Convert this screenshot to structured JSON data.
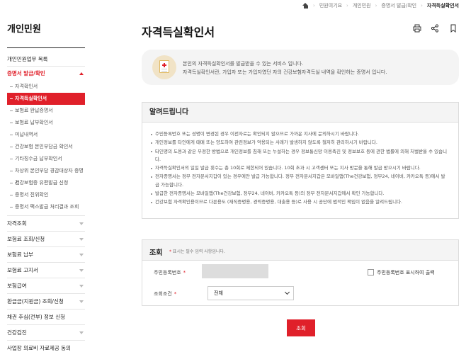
{
  "breadcrumb": {
    "items": [
      "민원여기요",
      "개인민원",
      "증명서 발급/확인"
    ],
    "current": "자격득실확인서"
  },
  "sidebar": {
    "title": "개인민원",
    "top_item": "개인민원업무 목록",
    "section": "증명서 발급/확인",
    "sub_items": [
      "자격확인서",
      "자격득실확인서",
      "보험료 완납증명서",
      "보험료 납부확인서",
      "미납내역서",
      "건강보험 본인부담금 확인서",
      "기타징수금 납부확인서",
      "차상위 본인부담 경감대상자 증명서",
      "건강보험증 유편발급 신청",
      "증명서 진위확인",
      "증명서 팩스발급 처리결과 조회"
    ],
    "main_items": [
      "자격조회",
      "보험료 조회/신청",
      "보험료 납부",
      "보험료 고지서",
      "보험급여",
      "환급금(지원금) 조회/신청",
      "채권 추심(전부) 정보 신청",
      "건강검진",
      "사업장 의료비 자료제공 동의"
    ]
  },
  "page": {
    "title": "자격득실확인서"
  },
  "intro": {
    "line1": "본인의 자격득실확인서를 발급받을 수 있는 서비스 입니다.",
    "line2": "자격득실확인서란, 가입자 또는 가입자였던 자의 건강보험자격득실 내역을 확인하는 증명서 입니다."
  },
  "notice": {
    "title": "알려드립니다",
    "items": [
      "주민등록번호 또는 성명이 변경된 경우 이전자료는 확인되지 않으므로 가까운 지사에 문의하시기 바랍니다.",
      "개인정보를 타인에게 때매 또는 양도하여 관련정보가 악용되는 사례가 발생하지 않도록 철저히 관리하시기 바랍니다.",
      "타인명의 도용과 같은 부정한 방법으로 개인정보를 침해 또는 누설하는 경우 정보통신망 이용촉진 및 정보보호 등에 관한 법률에 의해 처벌받을 수 있습니다.",
      "자격득실확인서의 일일 발급 횟수는 총 10회로 제한되어 있습니다. 10회 초과 시 고객센터 또는 지사 방문을 통해 발급 받으시기 바랍니다.",
      "전자증명서는 정부 전자문서지갑이 있는 경우에만 발급 가능합니다. 정부 전자문서지갑은 모바일앱(The건강보험, 정부24, 네이버, 카카오톡 등)에서 발급 가능합니다.",
      "발급한 전자증명서는 모바일앱(The건강보험, 정부24, 네이버, 카카오톡 등)의 정부 전자문서지갑에서 확인 가능합니다.",
      "건강보험 자격확인용이므로 다른용도 (재직증명용, 경력증명용, 대출용 등)로 사용 시 공단에 법적인 책임이 없음을 알려드립니다."
    ]
  },
  "query": {
    "title": "조회",
    "required_note_star": "*",
    "required_note": "표시는 필수 입력 사항입니다.",
    "id_label": "주민등록번호",
    "id_value": "",
    "show_id_label": "주민등록번호 표시하여 출력",
    "condition_label": "조회조건",
    "condition_value": "전체",
    "submit_label": "조회"
  },
  "colors": {
    "accent": "#e0202a",
    "panel": "#f4f4f4"
  },
  "icons": [
    "home-icon",
    "print-icon",
    "share-icon",
    "bookmark-icon",
    "certificate-icon",
    "chevron-down-icon"
  ]
}
